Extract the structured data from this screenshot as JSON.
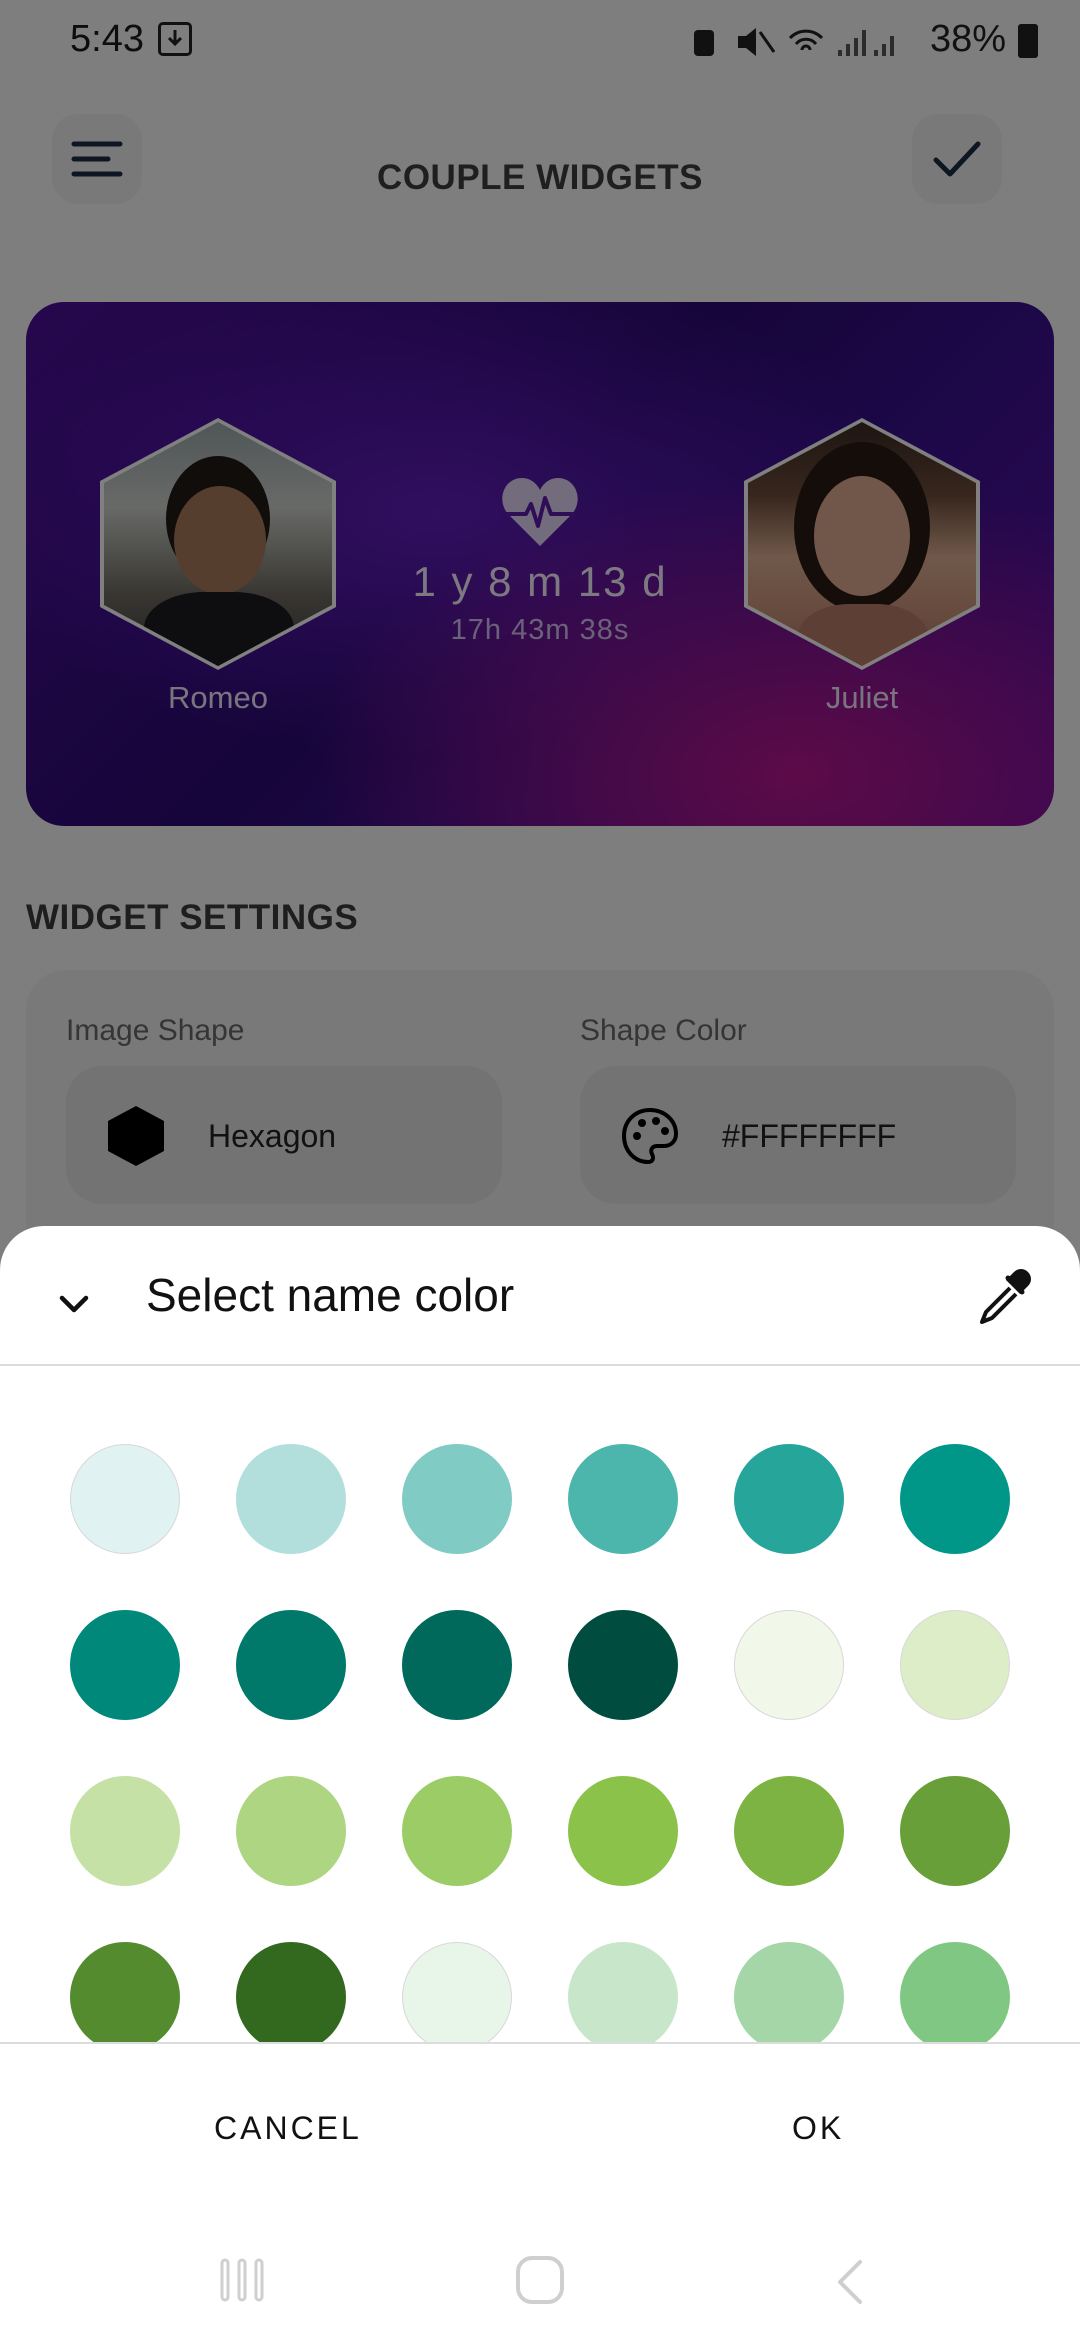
{
  "status_bar": {
    "time": "5:43",
    "battery": "38%"
  },
  "app_bar": {
    "title": "COUPLE WIDGETS"
  },
  "widget": {
    "person_left": "Romeo",
    "person_right": "Juliet",
    "duration": "1 y 8 m 13 d",
    "duration_detail": "17h 43m 38s"
  },
  "settings": {
    "section_title": "WIDGET SETTINGS",
    "image_shape_label": "Image Shape",
    "image_shape_value": "Hexagon",
    "shape_color_label": "Shape Color",
    "shape_color_value": "#FFFFFFFF"
  },
  "dialog": {
    "title": "Select name color",
    "cancel_label": "CANCEL",
    "ok_label": "OK",
    "swatches": [
      "#e0f2f1",
      "#b2dfdb",
      "#80cbc4",
      "#4db6ac",
      "#26a69a",
      "#009688",
      "#00897b",
      "#00796b",
      "#00695c",
      "#004d40",
      "#f1f8e9",
      "#dcedc8",
      "#c5e1a5",
      "#aed581",
      "#9ccc65",
      "#8bc34a",
      "#7cb342",
      "#689f38",
      "#558b2f",
      "#33691e",
      "#e8f5e9",
      "#c8e6c9",
      "#a5d6a7",
      "#81c784"
    ]
  }
}
